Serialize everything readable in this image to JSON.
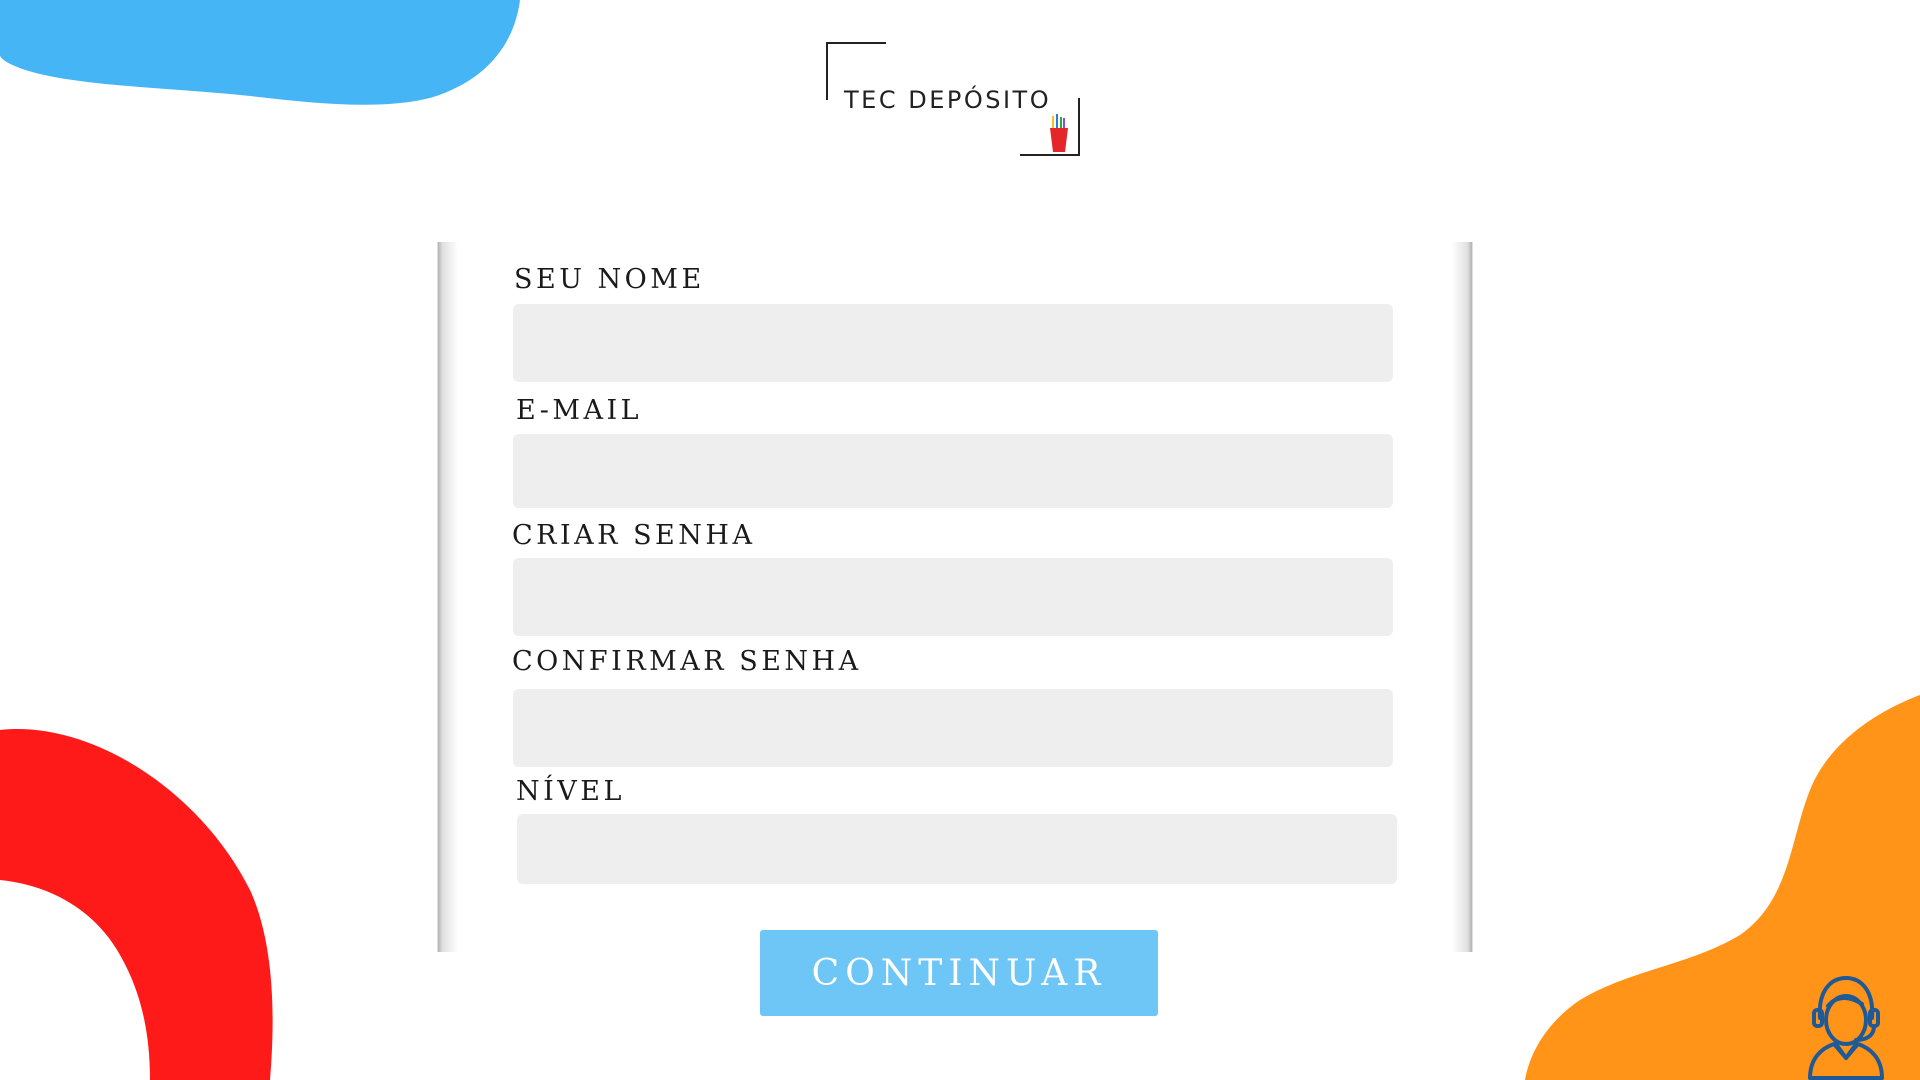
{
  "brand": {
    "name": "TEC DEPÓSITO"
  },
  "form": {
    "fields": [
      {
        "label": "SEU NOME",
        "value": "",
        "placeholder": ""
      },
      {
        "label": "E-MAIL",
        "value": "",
        "placeholder": ""
      },
      {
        "label": "CRIAR SENHA",
        "value": "",
        "placeholder": ""
      },
      {
        "label": "CONFIRMAR SENHA",
        "value": "",
        "placeholder": ""
      },
      {
        "label": "NÍVEL",
        "value": "",
        "placeholder": ""
      }
    ],
    "submit_label": "CONTINUAR"
  },
  "colors": {
    "button": "#6ec6f7",
    "input_bg": "#eeeeee",
    "blob_blue": "#45b5f5",
    "blob_red": "#ff1a1a",
    "blob_orange": "#ff9419",
    "support_icon": "#1f5a96"
  },
  "icons": {
    "logo": "pencil-cup-icon",
    "support": "support-agent-headset-icon"
  }
}
